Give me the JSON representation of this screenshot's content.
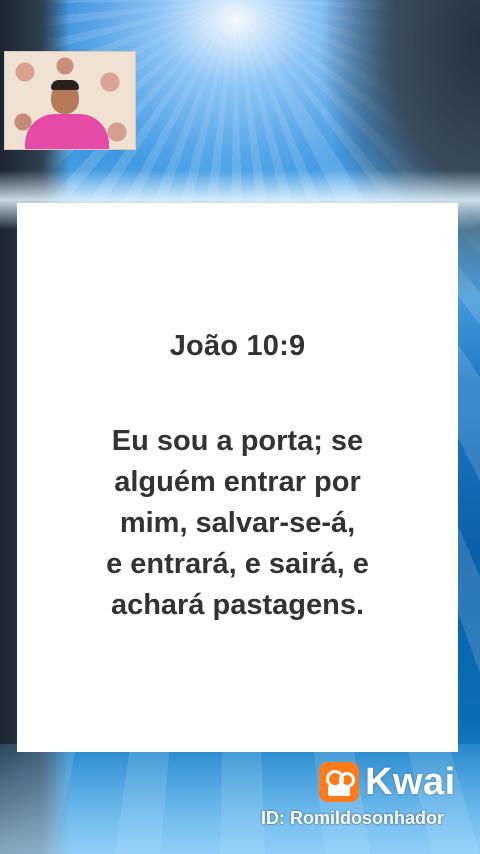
{
  "card": {
    "reference": "João 10:9",
    "verse_lines": [
      "Eu sou a porta; se",
      "alguém entrar por",
      "mim, salvar-se-á,",
      "e entrará, e sairá, e",
      "achará pastagens."
    ]
  },
  "watermark": {
    "brand": "Kwai",
    "user_id": "ID: Romildosonhador",
    "brand_color": "#ff7a1a"
  },
  "pip": {
    "icon": "camera-feed"
  }
}
